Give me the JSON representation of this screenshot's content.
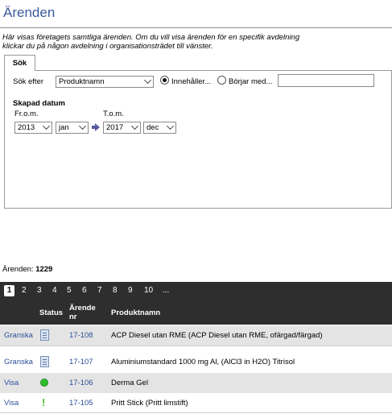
{
  "page": {
    "title": "Ärenden",
    "intro_line1": "Här visas företagets samtliga ärenden. Om du vill visa ärenden för en specifik avdelning",
    "intro_line2": "klickar du på någon avdelning i organisationsträdet till vänster."
  },
  "search": {
    "tab_label": "Sök",
    "search_by_label": "Sök efter",
    "field_value": "Produktnamn",
    "radio_contains_label": "Innehåller...",
    "radio_starts_label": "Börjar med...",
    "radio_selected": "contains",
    "text_value": "",
    "created_label": "Skapad datum",
    "from_label": "Fr.o.m.",
    "to_label": "T.o.m.",
    "from_year": "2013",
    "from_month": "jan",
    "to_year": "2017",
    "to_month": "dec"
  },
  "results": {
    "count_label": "Ärenden:",
    "count_value": "1229",
    "pages": [
      "1",
      "2",
      "3",
      "4",
      "5",
      "6",
      "7",
      "8",
      "9",
      "10",
      "..."
    ],
    "current_page": "1",
    "columns": {
      "status": "Status",
      "case_nr_line1": "Ärende",
      "case_nr_line2": "nr",
      "product": "Produktnamn"
    },
    "rows": [
      {
        "action": "Granska",
        "status_icon": "document-icon",
        "case_nr": "17-108",
        "product": "ACP Diesel utan RME (ACP Diesel utan RME, ofärgad/färgad)"
      },
      {
        "action": "Granska",
        "status_icon": "document-icon",
        "case_nr": "17-107",
        "product": "Aluminiumstandard 1000 mg Al, (AlCl3 in H2O) Titrisol"
      },
      {
        "action": "Visa",
        "status_icon": "green-dot-icon",
        "case_nr": "17-106",
        "product": "Derma Gel"
      },
      {
        "action": "Visa",
        "status_icon": "exclamation-icon",
        "case_nr": "17-105",
        "product": "Pritt Stick (Pritt limstift)"
      }
    ]
  },
  "colors": {
    "title": "#3a5a9a",
    "link": "#2a4f9a",
    "grid_header_bg": "#2e2e2e",
    "row_alt_bg": "#e4e4e4",
    "status_ok": "#2fbf2f"
  }
}
